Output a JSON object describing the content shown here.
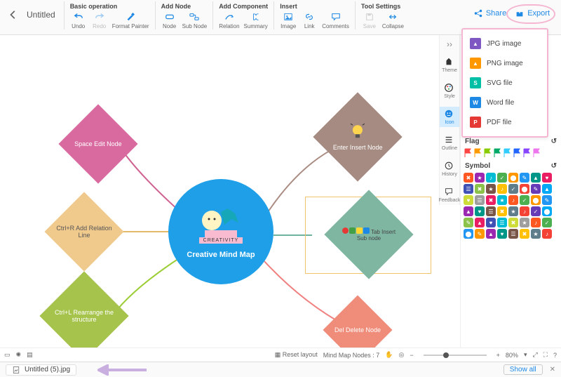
{
  "document_title": "Untitled",
  "toolbar_groups": {
    "basic": {
      "title": "Basic operation",
      "undo": "Undo",
      "redo": "Redo",
      "format": "Format Painter"
    },
    "add_node": {
      "title": "Add Node",
      "node": "Node",
      "sub": "Sub Node"
    },
    "add_comp": {
      "title": "Add Component",
      "relation": "Relation",
      "summary": "Summary"
    },
    "insert": {
      "title": "Insert",
      "image": "Image",
      "link": "Link",
      "comments": "Comments"
    },
    "tool": {
      "title": "Tool Settings",
      "save": "Save",
      "collapse": "Collapse"
    }
  },
  "share_label": "Share",
  "export_label": "Export",
  "export_menu": {
    "jpg": "JPG image",
    "png": "PNG image",
    "svg": "SVG file",
    "word": "Word file",
    "pdf": "PDF file"
  },
  "rail": {
    "theme": "Theme",
    "style": "Style",
    "icon": "Icon",
    "outline": "Outline",
    "history": "History",
    "feedback": "Feedback"
  },
  "panel": {
    "flag_title": "Flag",
    "symbol_title": "Symbol"
  },
  "flag_colors": [
    "#f44",
    "#f90",
    "#8c0",
    "#0a6",
    "#3cf",
    "#26f",
    "#84f",
    "#e7e"
  ],
  "symbol_colors": [
    "#ff5722",
    "#9c27b0",
    "#00bcd4",
    "#4caf50",
    "#ff9800",
    "#2196f3",
    "#009688",
    "#e91e63",
    "#3f51b5",
    "#8bc34a",
    "#795548",
    "#ffc107",
    "#607d8b",
    "#f44336",
    "#673ab7",
    "#03a9f4",
    "#cddc39",
    "#9e9e9e",
    "#e91e63",
    "#00bcd4",
    "#ff5722",
    "#4caf50",
    "#ff9800",
    "#2196f3",
    "#9c27b0",
    "#009688",
    "#795548",
    "#ffc107",
    "#607d8b",
    "#f44336",
    "#673ab7",
    "#03a9f4",
    "#8bc34a",
    "#e91e63",
    "#3f51b5",
    "#00bcd4",
    "#cddc39",
    "#9e9e9e",
    "#ff5722",
    "#4caf50",
    "#2196f3",
    "#ff9800",
    "#9c27b0",
    "#009688",
    "#795548",
    "#ffc107",
    "#607d8b",
    "#f44336"
  ],
  "mindmap": {
    "center": "Creative Mind Map",
    "center_tag": "CREATIVITY",
    "nodes": {
      "tl": "Space Edit Node",
      "ml": "Ctrl+R Add Relation Line",
      "bl": "Ctrl+L Rearrange the structure",
      "tr": "Enter Insert Node",
      "mr": "Tab Insert Sub node",
      "br": "Del Delete Node"
    }
  },
  "status": {
    "reset": "Reset layout",
    "nodes_label": "Mind Map Nodes :",
    "nodes_count": "7",
    "zoom": "80%"
  },
  "download": {
    "filename": "Untitled (5).jpg",
    "showall": "Show all"
  }
}
